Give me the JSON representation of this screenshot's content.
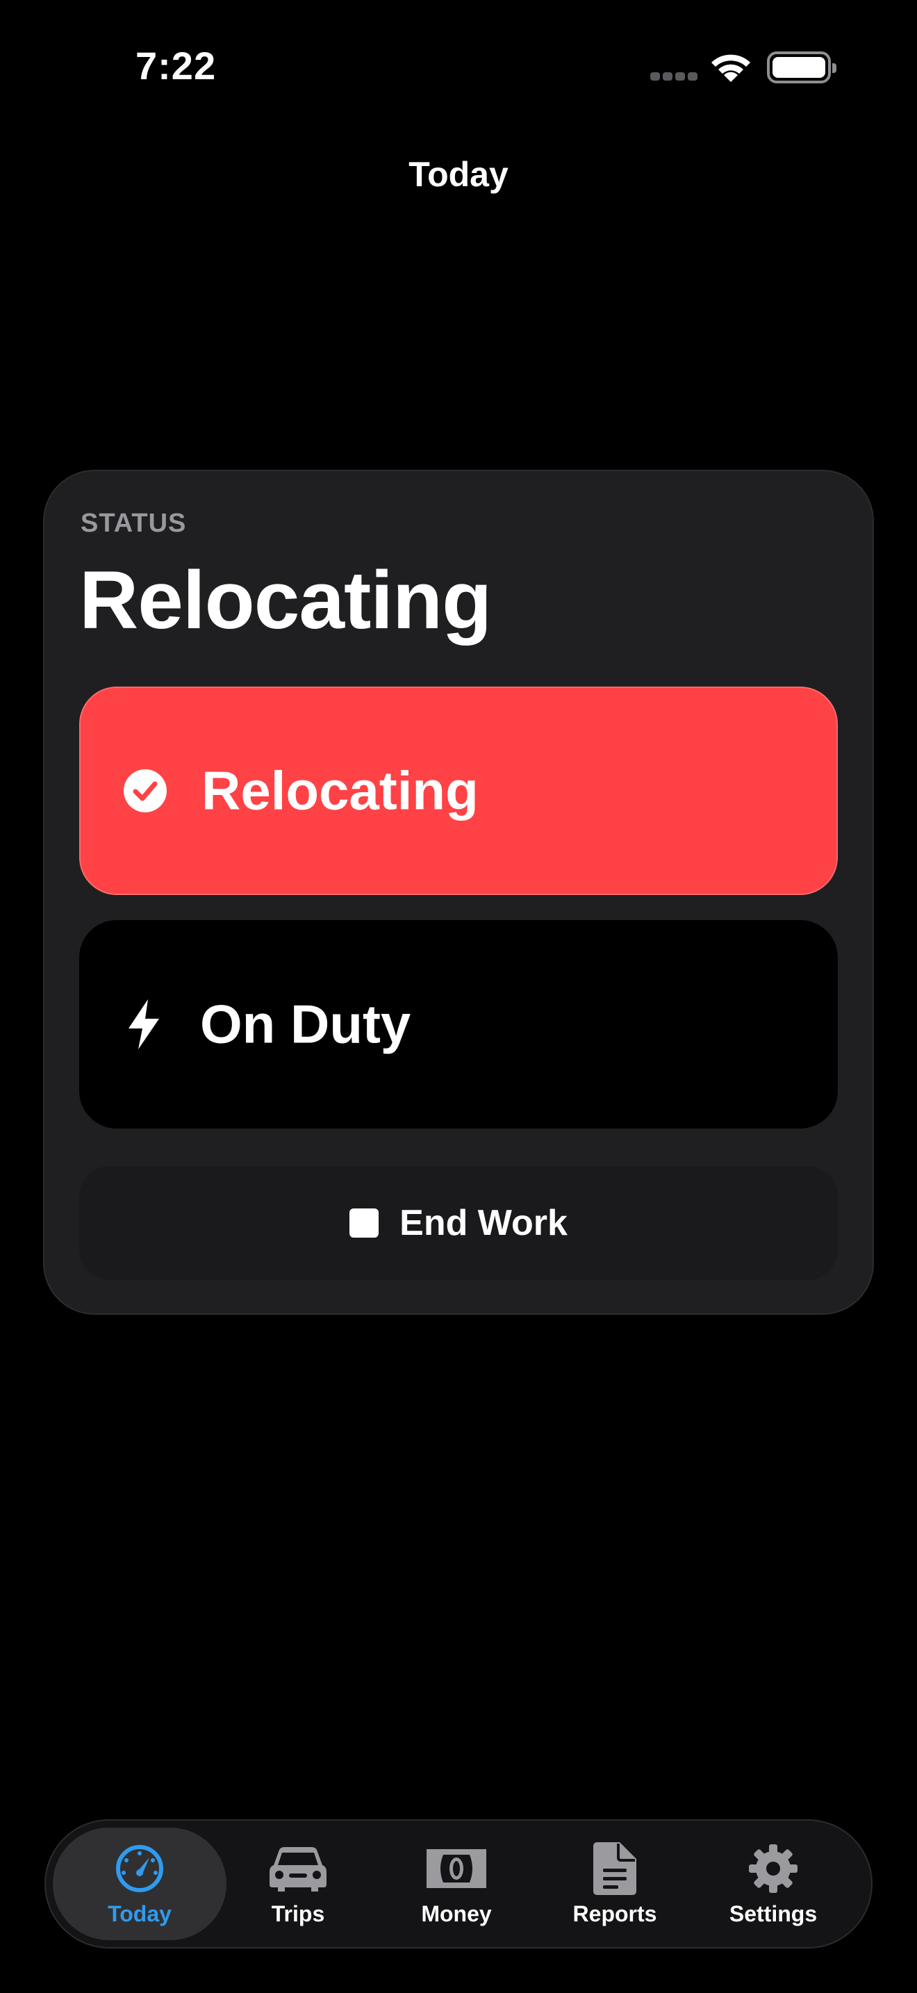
{
  "status_bar": {
    "time": "7:22"
  },
  "nav": {
    "title": "Today"
  },
  "status_card": {
    "label": "STATUS",
    "current": "Relocating",
    "options": [
      {
        "label": "Relocating",
        "icon": "checkmark-circle-icon",
        "selected": true
      },
      {
        "label": "On Duty",
        "icon": "bolt-icon",
        "selected": false
      }
    ],
    "end_work_label": "End Work"
  },
  "tabs": [
    {
      "label": "Today",
      "icon": "speedometer-icon",
      "selected": true
    },
    {
      "label": "Trips",
      "icon": "car-icon",
      "selected": false
    },
    {
      "label": "Money",
      "icon": "banknote-icon",
      "selected": false
    },
    {
      "label": "Reports",
      "icon": "document-icon",
      "selected": false
    },
    {
      "label": "Settings",
      "icon": "gear-icon",
      "selected": false
    }
  ],
  "colors": {
    "accent": "#2f9bef",
    "active_status": "#ff4245",
    "card_bg": "#1f1f21",
    "background": "#000000"
  }
}
